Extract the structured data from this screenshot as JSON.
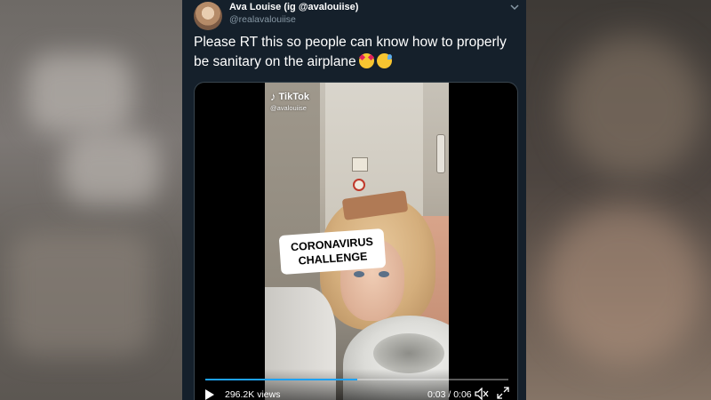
{
  "tweet": {
    "display_name": "Ava Louise (ig @avalouiise)",
    "handle": "@realavalouiise",
    "text": "Please RT this so people can know how to properly be sanitary on the airplane",
    "emojis": [
      "smiling-face-with-hearts",
      "grinning-face-with-sweat"
    ]
  },
  "video": {
    "watermark_app": "TikTok",
    "watermark_user": "@avalouiise",
    "caption": "CORONAVIRUS CHALLENGE",
    "views": "296.2K views",
    "timecode": "0:03 / 0:06",
    "progress_fraction": 0.5
  },
  "colors": {
    "tweet_bg": "#15202b",
    "secondary_text": "#8899a6",
    "accent": "#1da1f2"
  },
  "icons": [
    "caret-down-icon",
    "play-icon",
    "mute-icon",
    "fullscreen-icon",
    "tiktok-logo-icon"
  ]
}
